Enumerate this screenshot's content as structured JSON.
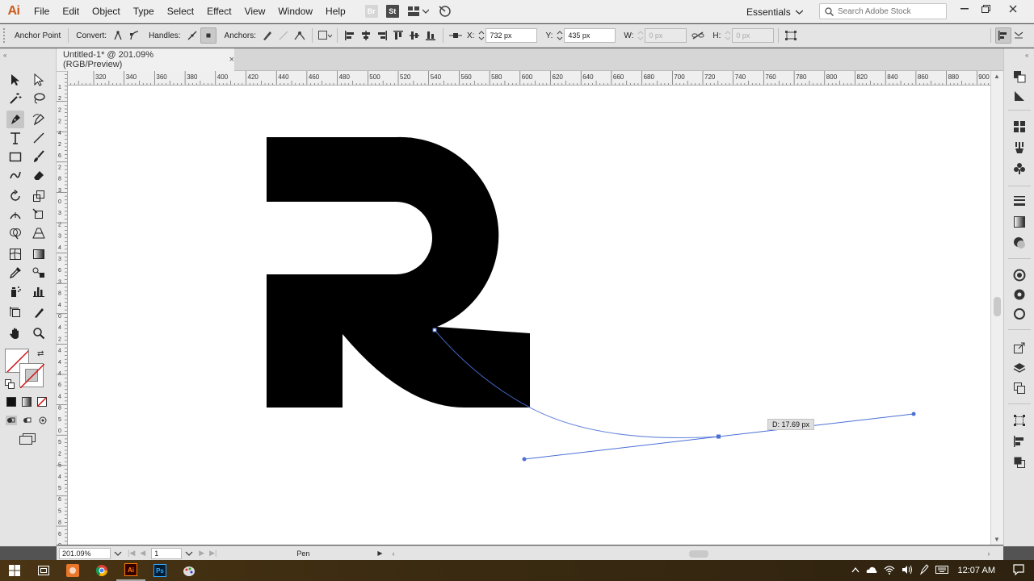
{
  "app": {
    "logo": "Ai"
  },
  "menu": [
    "File",
    "Edit",
    "Object",
    "Type",
    "Select",
    "Effect",
    "View",
    "Window",
    "Help"
  ],
  "menu_icons": {
    "bridge": "Br",
    "stock": "St"
  },
  "workspace": "Essentials",
  "search": {
    "placeholder": "Search Adobe Stock"
  },
  "control": {
    "anchor_point": "Anchor Point",
    "convert": "Convert:",
    "handles": "Handles:",
    "anchors": "Anchors:",
    "x_label": "X:",
    "x_value": "732 px",
    "y_label": "Y:",
    "y_value": "435 px",
    "w_label": "W:",
    "w_value": "0 px",
    "h_label": "H:",
    "h_value": "0 px"
  },
  "document": {
    "tab_title": "Untitled-1* @ 201.09% (RGB/Preview)",
    "close": "×"
  },
  "ruler": {
    "top": [
      "320",
      "340",
      "360",
      "380",
      "400",
      "420",
      "440",
      "460",
      "480",
      "500",
      "520",
      "540",
      "560",
      "580",
      "600",
      "620",
      "640",
      "660",
      "680",
      "700",
      "720",
      "740",
      "760",
      "780",
      "800",
      "820",
      "840",
      "860",
      "880",
      "900"
    ],
    "left": [
      "1",
      "2",
      "2",
      "2",
      "4",
      "2",
      "6",
      "2",
      "8",
      "3",
      "0",
      "3",
      "2",
      "3",
      "4",
      "3",
      "6",
      "3",
      "8",
      "4",
      "0",
      "4",
      "2",
      "4",
      "4",
      "4",
      "6",
      "4",
      "8",
      "5",
      "0",
      "5",
      "2",
      "5",
      "4",
      "5",
      "6",
      "5",
      "8",
      "6",
      "0"
    ]
  },
  "measure_tip": "D: 17.69 px",
  "status": {
    "zoom": "201.09%",
    "artboard": "1",
    "tool": "Pen"
  },
  "taskbar": {
    "time": "12:07 AM",
    "ps_label": "Ps",
    "ai_label": "Ai"
  },
  "colors": {
    "accent": "#cc5a1a",
    "path_blue": "#4a6fd6",
    "fill": "#000000"
  }
}
